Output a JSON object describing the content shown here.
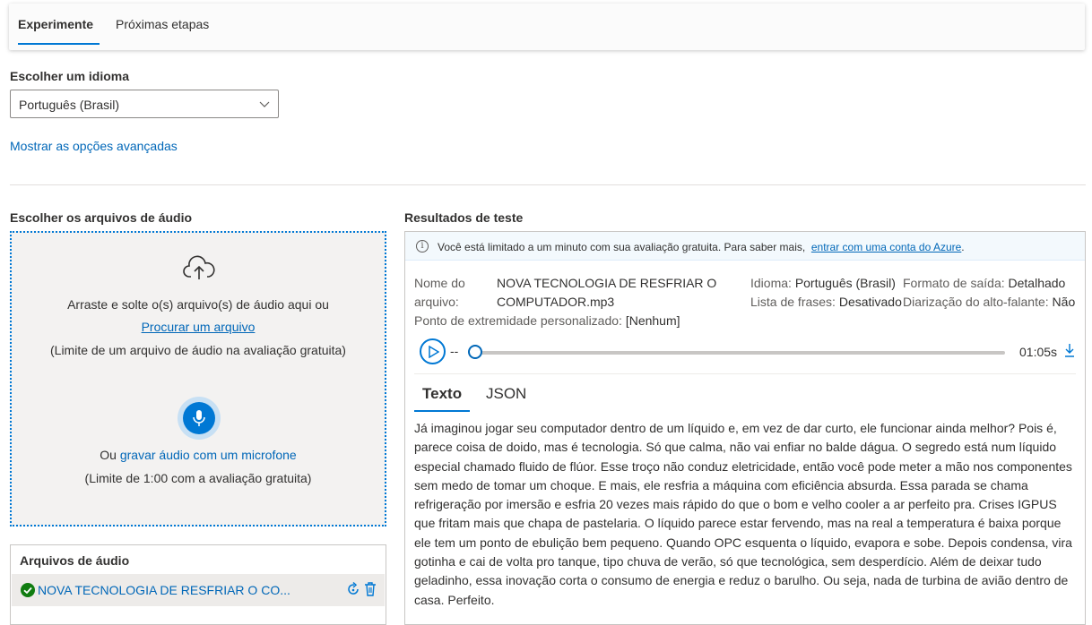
{
  "tabs": {
    "experiment": "Experimente",
    "next_steps": "Próximas etapas"
  },
  "language": {
    "label": "Escolher um idioma",
    "selected": "Português (Brasil)"
  },
  "advanced_link": "Mostrar as opções avançadas",
  "upload": {
    "section_title": "Escolher os arquivos de áudio",
    "drag_text": "Arraste e solte o(s) arquivo(s) de áudio aqui ou",
    "browse_link": "Procurar um arquivo",
    "limit_text": "(Limite de um arquivo de áudio na avaliação gratuita)",
    "mic_prefix": "Ou",
    "mic_link": "gravar áudio com um microfone",
    "mic_limit": "(Limite de 1:00 com a avaliação gratuita)",
    "icon": "upload-cloud-icon",
    "mic_icon": "microphone-icon"
  },
  "files": {
    "title": "Arquivos de áudio",
    "items": [
      {
        "name": "NOVA TECNOLOGIA DE RESFRIAR O CO..."
      }
    ]
  },
  "results": {
    "section_title": "Resultados de teste",
    "banner_text": "Você está limitado a um minuto com sua avaliação gratuita. Para saber mais,",
    "banner_link": "entrar com uma conta do Azure",
    "file_label_1": "Nome do",
    "file_label_2": "arquivo:",
    "file_value_1": "NOVA TECNOLOGIA DE RESFRIAR O",
    "file_value_2": "COMPUTADOR.mp3",
    "language_label": "Idioma:",
    "language_value": "Português (Brasil)",
    "output_label": "Formato de saída:",
    "output_value": "Detalhado",
    "phrases_label": "Lista de frases:",
    "phrases_value": "Desativado",
    "diarization_label": "Diarização do alto-falante:",
    "diarization_value": "Não",
    "endpoint_label": "Ponto de extremidade personalizado:",
    "endpoint_value": "[Nenhum]",
    "player": {
      "position": "--",
      "duration": "01:05s"
    },
    "tabs": {
      "text": "Texto",
      "json": "JSON"
    },
    "transcript": "Já imaginou jogar seu computador dentro de um líquido e, em vez de dar curto, ele funcionar ainda melhor? Pois é, parece coisa de doido, mas é tecnologia. Só que calma, não vai enfiar no balde dágua. O segredo está num líquido especial chamado fluido de flúor. Esse troço não conduz eletricidade, então você pode meter a mão nos componentes sem medo de tomar um choque. E mais, ele resfria a máquina com eficiência absurda. Essa parada se chama refrigeração por imersão e esfria 20 vezes mais rápido do que o bom e velho cooler a ar perfeito pra. Crises IGPUS que fritam mais que chapa de pastelaria. O líquido parece estar fervendo, mas na real a temperatura é baixa porque ele tem um ponto de ebulição bem pequeno. Quando OPC esquenta o líquido, evapora e sobe. Depois condensa, vira gotinha e cai de volta pro tanque, tipo chuva de verão, só que tecnológica, sem desperdício. Além de deixar tudo geladinho, essa inovação corta o consumo de energia e reduz o barulho. Ou seja, nada de turbina de avião dentro de casa. Perfeito."
  },
  "colors": {
    "accent": "#0078d4",
    "link": "#0067b8",
    "success": "#107c10"
  }
}
